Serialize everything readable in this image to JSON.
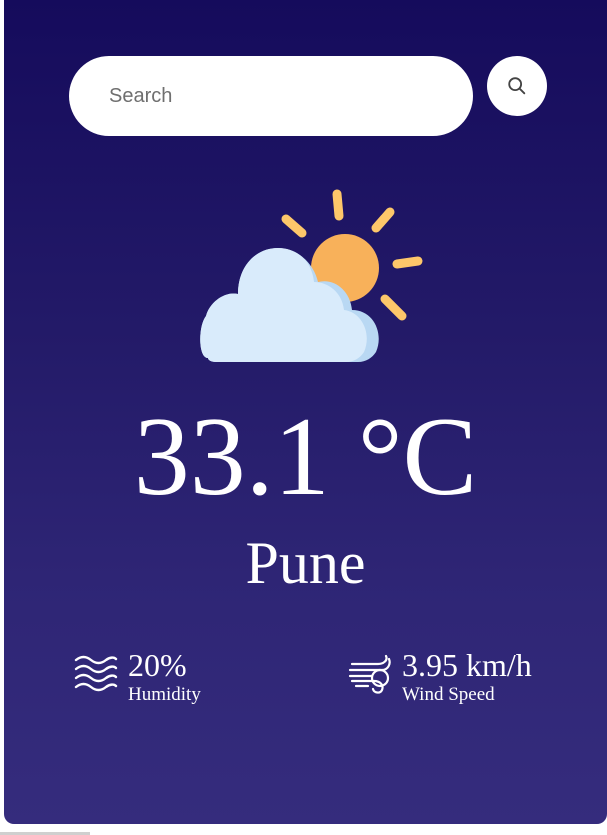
{
  "search": {
    "placeholder": "Search",
    "value": "",
    "button_icon": "search-icon"
  },
  "weather": {
    "icon": "partly-cloudy-sun-icon",
    "temperature": "33.1 °C",
    "city": "Pune"
  },
  "stats": {
    "humidity": {
      "icon": "humidity-waves-icon",
      "value": "20%",
      "label": "Humidity"
    },
    "wind": {
      "icon": "wind-icon",
      "value": "3.95 km/h",
      "label": "Wind Speed"
    }
  },
  "colors": {
    "card_top": "#150b5c",
    "card_bottom": "#352c7d",
    "sun": "#f8b15a",
    "sun_rays": "#fdc76a",
    "cloud": "#d9ebfb",
    "cloud_shade": "#b9d8f3",
    "text": "#ffffff"
  }
}
